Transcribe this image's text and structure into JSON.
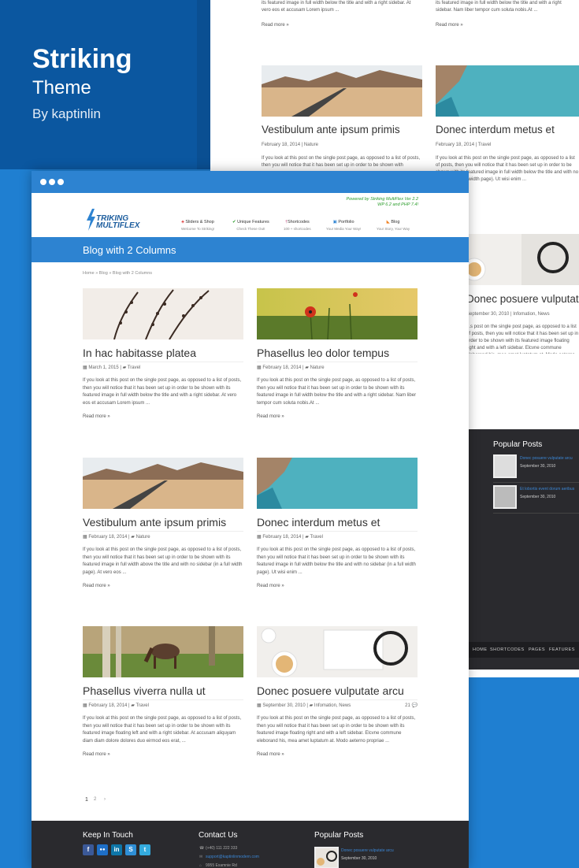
{
  "promo": {
    "title": "Striking",
    "subtitle": "Theme",
    "author": "By kaptinlin"
  },
  "back_site": {
    "top_excerpts": [
      "its featured image in full width below the title and with a right sidebar. At vero eos et accusam Lorem ipsum ...",
      "its featured image in full width below the title and with a right sidebar. Nam liber tempor cum soluta nobis.At ..."
    ],
    "read_more": "Read more »",
    "posts": [
      {
        "title": "Vestibulum ante ipsum primis",
        "meta": "February 18, 2014 | Nature",
        "excerpt": "If you look at this post on the single post page, as opposed to a list of posts, then you will notice that it has been set up in order to be shown with"
      },
      {
        "title": "Donec interdum metus et",
        "meta": "February 18, 2014 | Travel",
        "excerpt": "If you look at this post on the single post page, as opposed to a list of posts, then you will notice that it has been set up in order to be shown with its featured image in full width below the title and with no sidebar (i... ...t) width page). Ut wisi enim ..."
      },
      {
        "title": "Donec posuere vulputate arcu",
        "meta": "September 30, 2010 | Infomation, News",
        "excerpt": "...s post on the single post page, as opposed to a list of posts, then you will notice that it has been set up in order to be shown with its featured image floating right and with a left sidebar. Elcvne commune eleborand his, mea amet luptatum at. Modo aeterno propriae ..."
      }
    ],
    "footer": {
      "popular_title": "Popular Posts",
      "items": [
        {
          "link": "Donec posuere vulputate arcu",
          "date": "September 30, 2010"
        },
        {
          "link": "Et lobortis event dorum aeribus",
          "date": "September 30, 2010"
        }
      ],
      "bottom_nav": [
        "HOME",
        "SHORTCODES",
        "PAGES",
        "FEATURES"
      ]
    }
  },
  "site": {
    "powered": [
      "Powered by Striking MultiFlex Ver 2.2",
      "WP 6.2 and PHP 7.4!"
    ],
    "logo": [
      "TRIKING",
      "MULTIFLEX"
    ],
    "nav": [
      {
        "label": "Sliders & Shop",
        "sub": "Welcome To Striking!",
        "icon": "sliders-icon"
      },
      {
        "label": "Unique Features",
        "sub": "Check These Out!",
        "icon": "check-icon"
      },
      {
        "label": "Shortcodes",
        "sub": "100 + shortcodes",
        "icon": "shortcodes-icon"
      },
      {
        "label": "Portfolio",
        "sub": "Your Media Your Way!",
        "icon": "image-icon"
      },
      {
        "label": "Blog",
        "sub": "Your Story, Your Way",
        "icon": "rss-icon"
      }
    ],
    "page_title": "Blog with 2 Columns",
    "breadcrumb": "Home » Blog » Blog with 2 Columns",
    "read_more": "Read more »",
    "posts": [
      {
        "title": "In hac habitasse platea",
        "date": "March 1, 2015",
        "cats": "Travel",
        "comments": "",
        "excerpt": "If you look at this post on the single post page, as opposed to a list of posts, then you will notice that it has been set up in order to be shown with its featured image in full width below the title and with a right sidebar. At vero eos et accusam Lorem ipsum ..."
      },
      {
        "title": "Phasellus leo dolor tempus",
        "date": "February 18, 2014",
        "cats": "Nature",
        "comments": "",
        "excerpt": "If you look at this post on the single post page, as opposed to a list of posts, then you will notice that it has been set up in order to be shown with its featured image in full width below the title and with a right sidebar. Nam liber tempor cum soluta nobis.At ..."
      },
      {
        "title": "Vestibulum ante ipsum primis",
        "date": "February 18, 2014",
        "cats": "Nature",
        "comments": "",
        "excerpt": "If you look at this post on the single post page, as opposed to a list of posts, then you will notice that it has been set up in order to be shown with its featured image in full width above the title and with no sidebar (in a full width page). At vero eos ..."
      },
      {
        "title": "Donec interdum metus et",
        "date": "February 18, 2014",
        "cats": "Travel",
        "comments": "",
        "excerpt": "If you look at this post on the single post page, as opposed to a list of posts, then you will notice that it has been set up in order to be shown with its featured image in full width below the title and with no sidebar (in a full width page). Ut wisi enim ..."
      },
      {
        "title": "Phasellus viverra nulla ut",
        "date": "February 18, 2014",
        "cats": "Travel",
        "comments": "",
        "excerpt": "If you look at this post on the single post page, as opposed to a list of posts, then you will notice that it has been set up in order to be shown with its featured image floating left and with a right sidebar. At accusam aliquyam diam diam dolore dolores duo eirmod eos erat, ..."
      },
      {
        "title": "Donec posuere vulputate arcu",
        "date": "September 30, 2010",
        "cats": "Infomation, News",
        "comments": "21",
        "excerpt": "If you look at this post on the single post page, as opposed to a list of posts, then you will notice that it has been set up in order to be shown with its featured image floating right and with a left sidebar. Elcvne commune eleborand his, mea amet luptatum at. Modo aeterno propriae ..."
      }
    ],
    "pagination": [
      "1",
      "2",
      "›"
    ],
    "footer": {
      "keep_in_touch": "Keep In Touch",
      "contact_us": "Contact Us",
      "popular_posts": "Popular Posts",
      "social": [
        {
          "icon": "facebook-icon",
          "glyph": "f",
          "color": "#3b5998"
        },
        {
          "icon": "flickr-icon",
          "glyph": "●●",
          "color": "#1e6fc7"
        },
        {
          "icon": "linkedin-icon",
          "glyph": "in",
          "color": "#0e76a8"
        },
        {
          "icon": "skype-icon",
          "glyph": "S",
          "color": "#2f8fd6"
        },
        {
          "icon": "twitter-icon",
          "glyph": "t",
          "color": "#33aadd"
        }
      ],
      "phone": "(+40) 111 222 333",
      "email": "support@kaptinlinmodern.com",
      "address": "9955 Examnie Rd",
      "pp_link": "Donec posuere vulputate arcu",
      "pp_date": "September 30, 2010"
    }
  }
}
